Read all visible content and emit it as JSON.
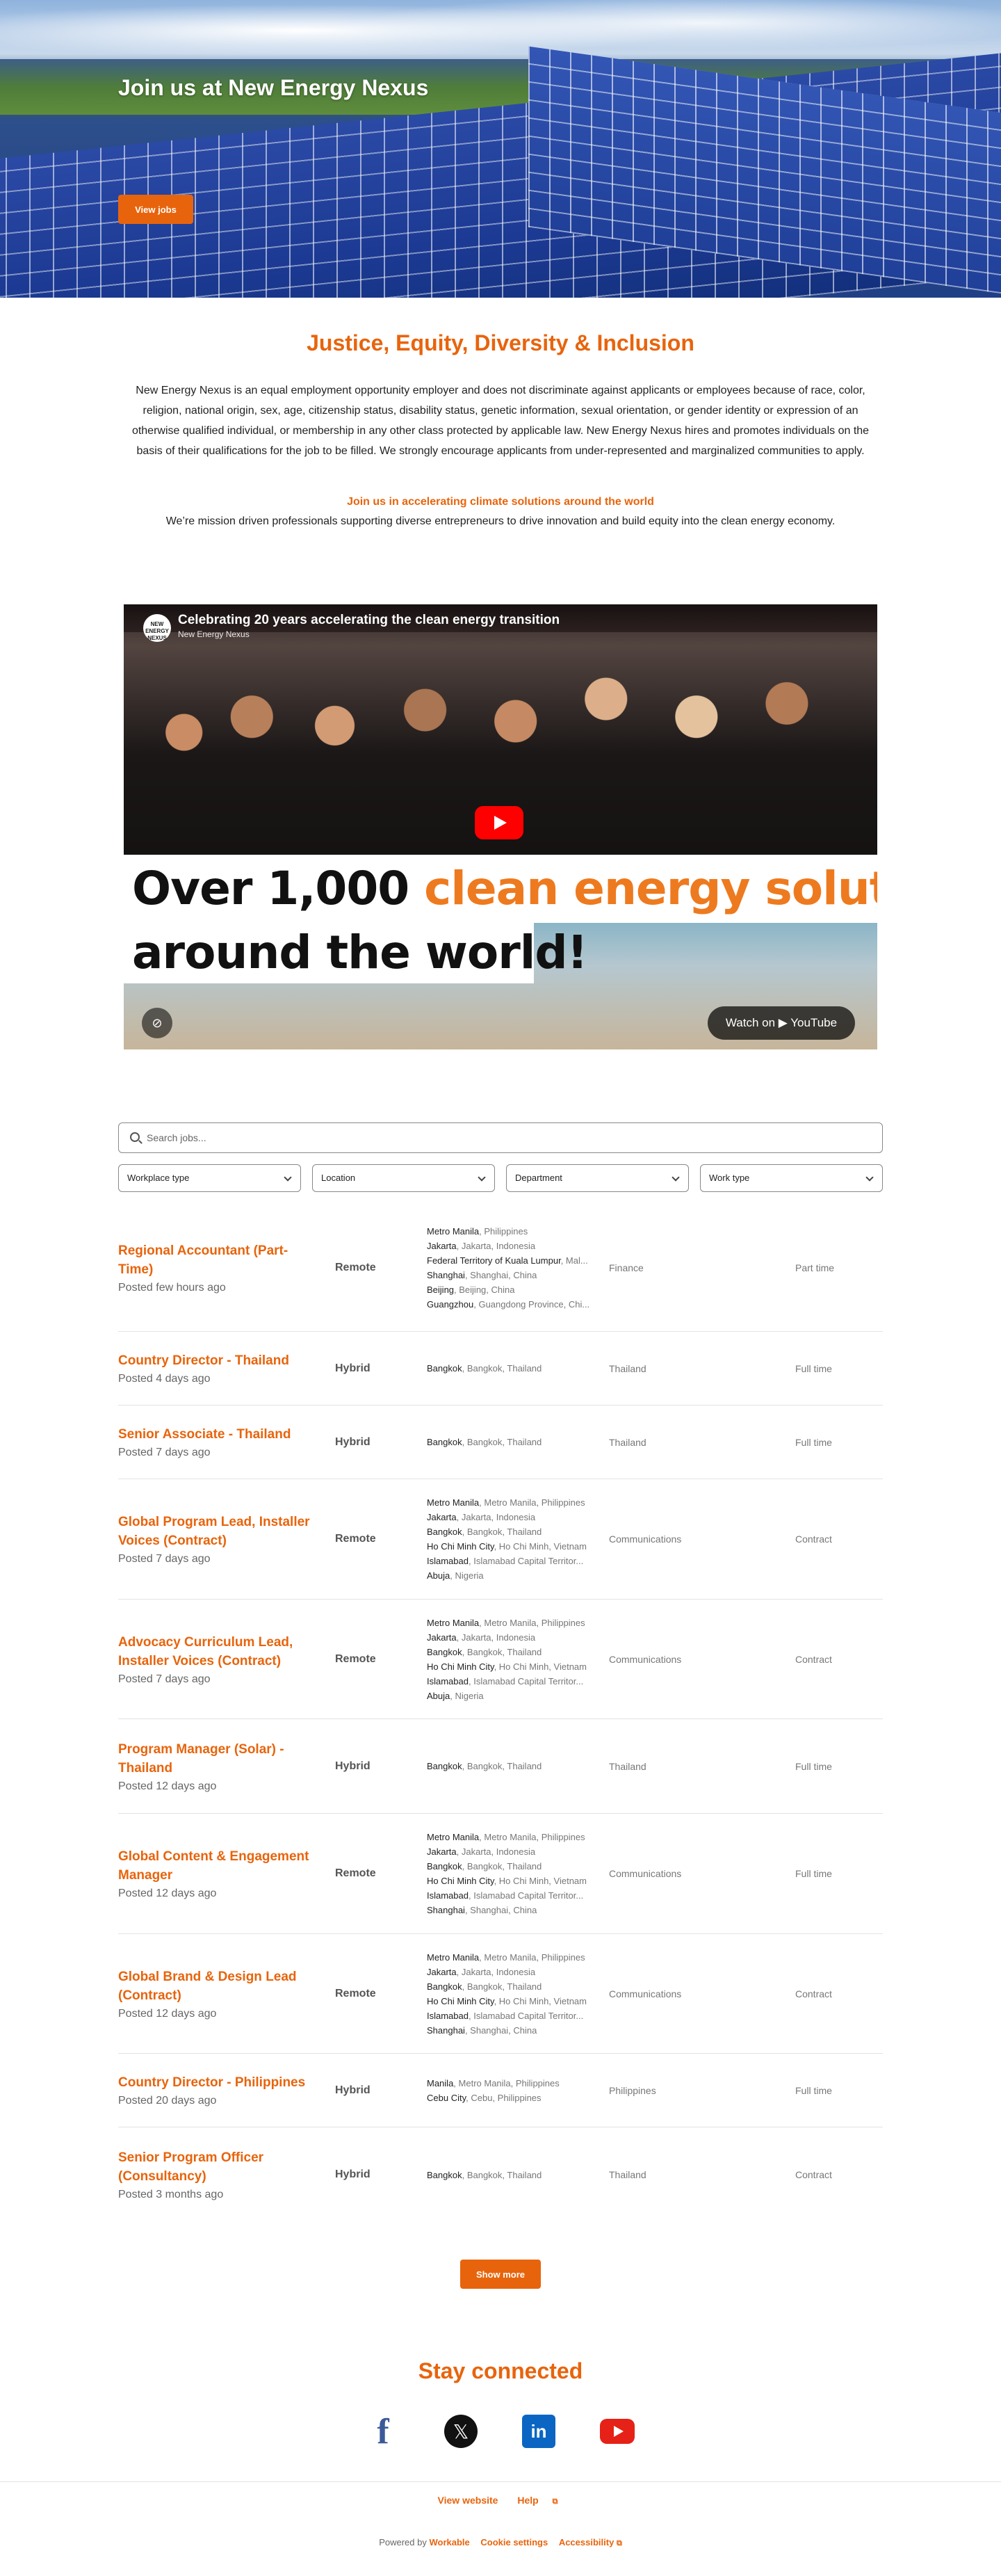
{
  "hero": {
    "title": "Join us at New Energy Nexus",
    "button_label": "View jobs"
  },
  "jedi": {
    "title": "Justice, Equity, Diversity & Inclusion",
    "text": "New Energy Nexus is an equal employment opportunity employer and does not discriminate against applicants or employees because of race, color, religion, national origin, sex, age, citizenship status, disability status, genetic information, sexual orientation, or gender identity or expression of an otherwise qualified individual, or membership in any other class protected by applicable law. New Energy Nexus hires and promotes individuals on the basis of their qualifications for the job to be filled. We strongly encourage applicants from under-represented and marginalized communities to apply.",
    "join_title": "Join us in accelerating climate solutions around the world",
    "join_text": "We’re mission driven professionals supporting diverse entrepreneurs to drive innovation and build equity into the clean energy economy."
  },
  "video": {
    "title": "Celebrating 20 years accelerating the clean energy transition",
    "channel": "New Energy Nexus",
    "avatar_text": "NEW ENERGY NEXUS",
    "banner_line1_a": "Over 1,000 ",
    "banner_line1_b": "clean energy solutions",
    "banner_line2": "around the world!",
    "watch_label": "Watch on ▶ YouTube"
  },
  "search": {
    "placeholder": "Search jobs..."
  },
  "filters": [
    "Workplace type",
    "Location",
    "Department",
    "Work type"
  ],
  "jobs": [
    {
      "title": "Regional Accountant (Part-Time)",
      "posted": "Posted few hours ago",
      "type": "Remote",
      "locations": [
        [
          "Metro Manila",
          ", Philippines"
        ],
        [
          "Jakarta",
          ", Jakarta, Indonesia"
        ],
        [
          "Federal Territory of Kuala Lumpur",
          ", Mal..."
        ],
        [
          "Shanghai",
          ", Shanghai, China"
        ],
        [
          "Beijing",
          ", Beijing, China"
        ],
        [
          "Guangzhou",
          ", Guangdong Province, Chi..."
        ]
      ],
      "department": "Finance",
      "work": "Part time"
    },
    {
      "title": "Country Director - Thailand",
      "posted": "Posted 4 days ago",
      "type": "Hybrid",
      "locations": [
        [
          "Bangkok",
          ", Bangkok, Thailand"
        ]
      ],
      "department": "Thailand",
      "work": "Full time"
    },
    {
      "title": "Senior Associate - Thailand",
      "posted": "Posted 7 days ago",
      "type": "Hybrid",
      "locations": [
        [
          "Bangkok",
          ", Bangkok, Thailand"
        ]
      ],
      "department": "Thailand",
      "work": "Full time"
    },
    {
      "title": "Global Program Lead, Installer Voices (Contract)",
      "posted": "Posted 7 days ago",
      "type": "Remote",
      "locations": [
        [
          "Metro Manila",
          ", Metro Manila, Philippines"
        ],
        [
          "Jakarta",
          ", Jakarta, Indonesia"
        ],
        [
          "Bangkok",
          ", Bangkok, Thailand"
        ],
        [
          "Ho Chi Minh City",
          ", Ho Chi Minh, Vietnam"
        ],
        [
          "Islamabad",
          ", Islamabad Capital Territor..."
        ],
        [
          "Abuja",
          ", Nigeria"
        ]
      ],
      "department": "Communications",
      "work": "Contract"
    },
    {
      "title": "Advocacy Curriculum Lead, Installer Voices (Contract)",
      "posted": "Posted 7 days ago",
      "type": "Remote",
      "locations": [
        [
          "Metro Manila",
          ", Metro Manila, Philippines"
        ],
        [
          "Jakarta",
          ", Jakarta, Indonesia"
        ],
        [
          "Bangkok",
          ", Bangkok, Thailand"
        ],
        [
          "Ho Chi Minh City",
          ", Ho Chi Minh, Vietnam"
        ],
        [
          "Islamabad",
          ", Islamabad Capital Territor..."
        ],
        [
          "Abuja",
          ", Nigeria"
        ]
      ],
      "department": "Communications",
      "work": "Contract"
    },
    {
      "title": "Program Manager (Solar) - Thailand",
      "posted": "Posted 12 days ago",
      "type": "Hybrid",
      "locations": [
        [
          "Bangkok",
          ", Bangkok, Thailand"
        ]
      ],
      "department": "Thailand",
      "work": "Full time"
    },
    {
      "title": "Global Content & Engagement Manager",
      "posted": "Posted 12 days ago",
      "type": "Remote",
      "locations": [
        [
          "Metro Manila",
          ", Metro Manila, Philippines"
        ],
        [
          "Jakarta",
          ", Jakarta, Indonesia"
        ],
        [
          "Bangkok",
          ", Bangkok, Thailand"
        ],
        [
          "Ho Chi Minh City",
          ", Ho Chi Minh, Vietnam"
        ],
        [
          "Islamabad",
          ", Islamabad Capital Territor..."
        ],
        [
          "Shanghai",
          ", Shanghai, China"
        ]
      ],
      "department": "Communications",
      "work": "Full time"
    },
    {
      "title": "Global Brand & Design Lead (Contract)",
      "posted": "Posted 12 days ago",
      "type": "Remote",
      "locations": [
        [
          "Metro Manila",
          ", Metro Manila, Philippines"
        ],
        [
          "Jakarta",
          ", Jakarta, Indonesia"
        ],
        [
          "Bangkok",
          ", Bangkok, Thailand"
        ],
        [
          "Ho Chi Minh City",
          ", Ho Chi Minh, Vietnam"
        ],
        [
          "Islamabad",
          ", Islamabad Capital Territor..."
        ],
        [
          "Shanghai",
          ", Shanghai, China"
        ]
      ],
      "department": "Communications",
      "work": "Contract"
    },
    {
      "title": "Country Director - Philippines",
      "posted": "Posted 20 days ago",
      "type": "Hybrid",
      "locations": [
        [
          "Manila",
          ", Metro Manila, Philippines"
        ],
        [
          "Cebu City",
          ", Cebu, Philippines"
        ]
      ],
      "department": "Philippines",
      "work": "Full time"
    },
    {
      "title": "Senior Program Officer (Consultancy)",
      "posted": "Posted 3 months ago",
      "type": "Hybrid",
      "locations": [
        [
          "Bangkok",
          ", Bangkok, Thailand"
        ]
      ],
      "department": "Thailand",
      "work": "Contract"
    }
  ],
  "show_more_label": "Show more",
  "stay_connected": "Stay connected",
  "socials": [
    "facebook-icon",
    "x-icon",
    "linkedin-icon",
    "youtube-icon"
  ],
  "footer": {
    "view_website": "View website",
    "help": "Help",
    "powered_by": "Powered by",
    "brand": "Workable",
    "cookie_settings": "Cookie settings",
    "accessibility": "Accessibility"
  },
  "colors": {
    "accent": "#e8640c",
    "link": "#e8640c"
  }
}
